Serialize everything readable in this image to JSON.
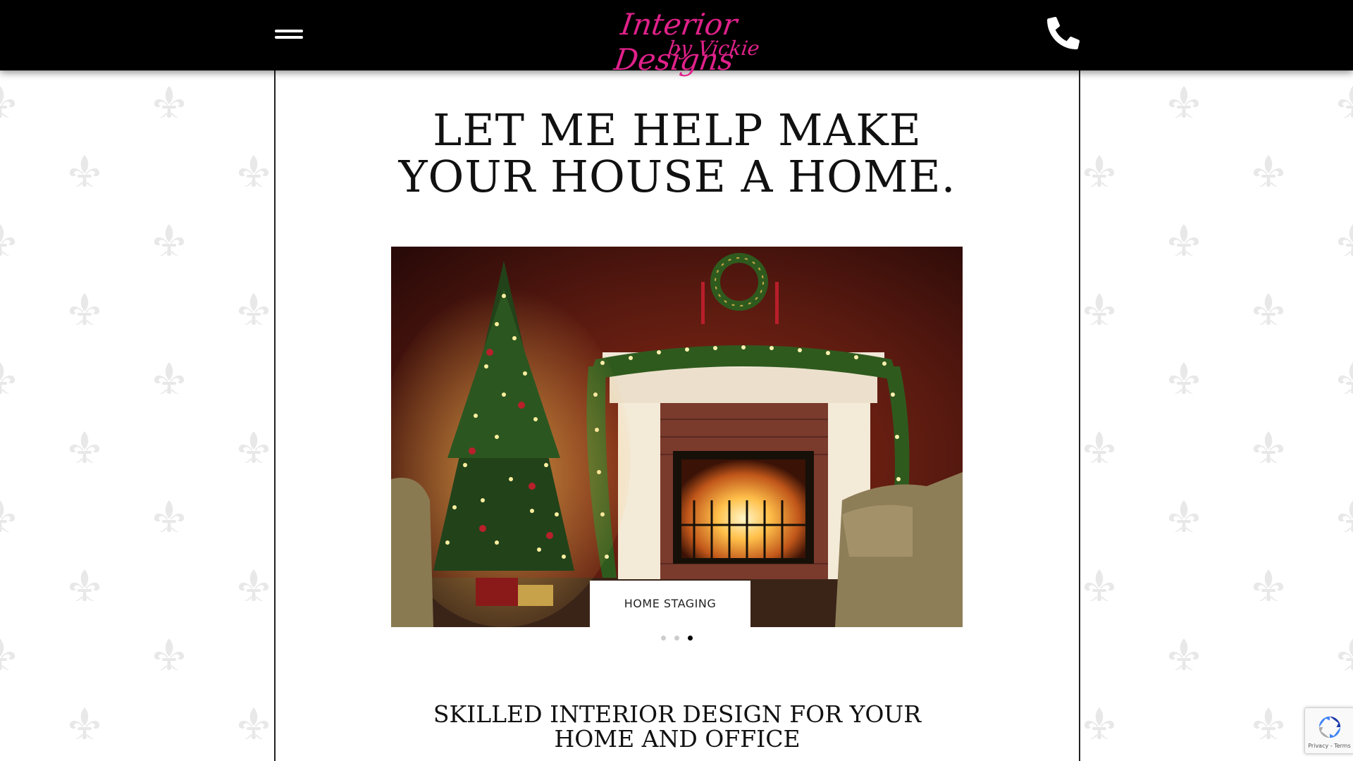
{
  "header": {
    "logo": {
      "line1": "Interior Designs",
      "line2": "by Vickie"
    },
    "menu_icon": "hamburger-icon",
    "phone_icon": "phone-icon"
  },
  "hero": {
    "title_line1": "LET ME HELP MAKE",
    "title_line2": "YOUR HOUSE A HOME."
  },
  "slider": {
    "caption": "HOME STAGING",
    "slide_count": 3,
    "active_slide": 3
  },
  "section": {
    "title_line1": "SKILLED INTERIOR DESIGN FOR YOUR",
    "title_line2": "HOME AND OFFICE"
  },
  "recaptcha": {
    "text": "Privacy - Terms"
  },
  "colors": {
    "header_bg": "#000000",
    "logo_pink": "#e0218a",
    "page_bg": "#ffffff",
    "pattern": "#e8e8e8",
    "frame_border": "#222222"
  }
}
